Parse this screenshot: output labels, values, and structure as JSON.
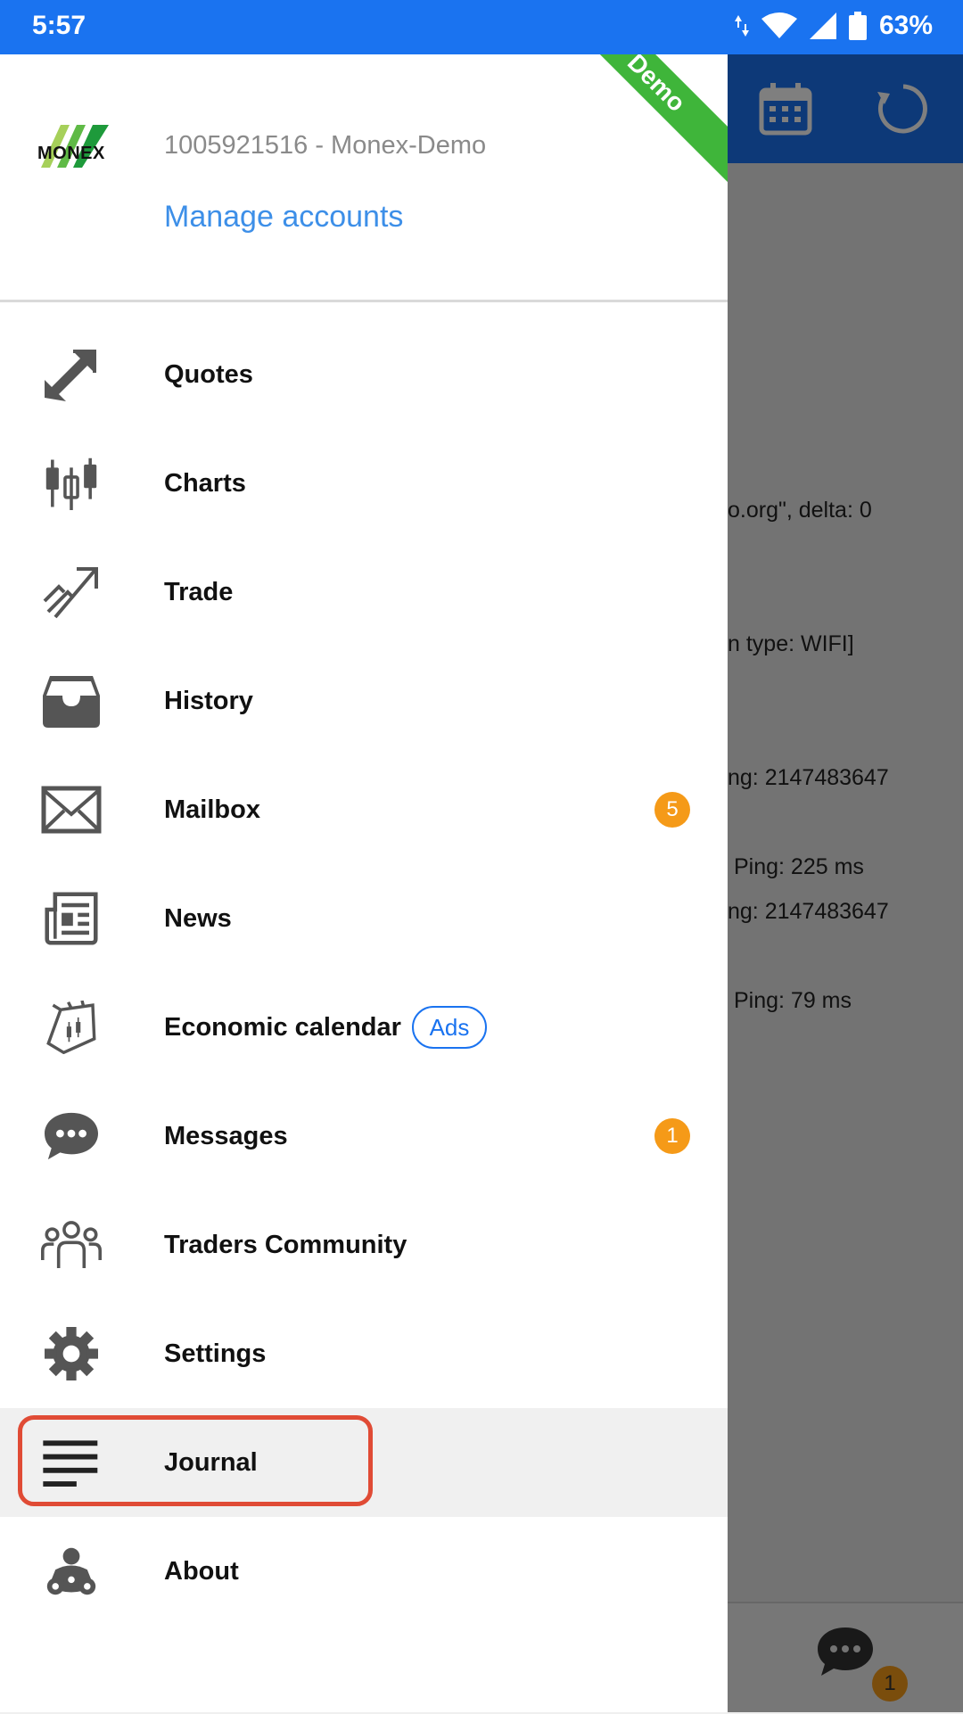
{
  "status_bar": {
    "time": "5:57",
    "battery": "63%"
  },
  "background": {
    "log_lines": [
      "o.org\", delta: 0",
      "n type: WIFI]",
      "ng: 2147483647",
      "Ping: 225 ms",
      "ng: 2147483647",
      "Ping: 79 ms"
    ],
    "chat_badge": "1"
  },
  "drawer": {
    "ribbon": "Demo",
    "brand": "MONEX",
    "account": "1005921516 - Monex-Demo",
    "manage_accounts": "Manage accounts",
    "items": [
      {
        "label": "Quotes",
        "icon": "quotes-icon"
      },
      {
        "label": "Charts",
        "icon": "charts-icon"
      },
      {
        "label": "Trade",
        "icon": "trade-icon"
      },
      {
        "label": "History",
        "icon": "history-icon"
      },
      {
        "label": "Mailbox",
        "icon": "mailbox-icon",
        "badge": "5"
      },
      {
        "label": "News",
        "icon": "news-icon"
      },
      {
        "label": "Economic calendar",
        "icon": "economic-calendar-icon",
        "tag": "Ads"
      },
      {
        "label": "Messages",
        "icon": "messages-icon",
        "badge": "1"
      },
      {
        "label": "Traders Community",
        "icon": "traders-community-icon"
      },
      {
        "label": "Settings",
        "icon": "settings-icon"
      },
      {
        "label": "Journal",
        "icon": "journal-icon",
        "active": true
      },
      {
        "label": "About",
        "icon": "about-icon"
      }
    ]
  },
  "colors": {
    "primary": "#1a73f0",
    "badge": "#f59a18",
    "ribbon": "#3fb53a",
    "highlight": "#e04b35"
  }
}
